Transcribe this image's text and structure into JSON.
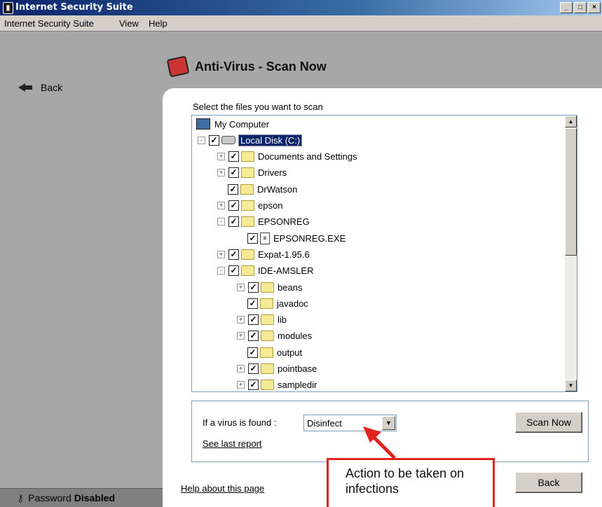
{
  "window": {
    "title": "Internet Security Suite",
    "min": "_",
    "max": "□",
    "close": "×"
  },
  "menu": [
    "Internet Security Suite",
    "View",
    "Help"
  ],
  "sidebar": {
    "back_label": "Back",
    "password_label": "Password",
    "password_status": "Disabled"
  },
  "header": {
    "title": "Anti-Virus - Scan Now"
  },
  "scan": {
    "prompt": "Select the files you want to scan",
    "tree": [
      {
        "label": "My Computer",
        "level": 0,
        "type": "computer"
      },
      {
        "label": "Local Disk (C:)",
        "level": 1,
        "type": "drive",
        "expander": "-",
        "checked": true,
        "selected": true
      },
      {
        "label": "Documents and Settings",
        "level": 2,
        "type": "folder",
        "expander": "+",
        "checked": true
      },
      {
        "label": "Drivers",
        "level": 2,
        "type": "folder",
        "expander": "+",
        "checked": true
      },
      {
        "label": "DrWatson",
        "level": 2,
        "type": "folder",
        "expander": "",
        "checked": true
      },
      {
        "label": "epson",
        "level": 2,
        "type": "folder",
        "expander": "+",
        "checked": true
      },
      {
        "label": "EPSONREG",
        "level": 2,
        "type": "folder",
        "expander": "-",
        "checked": true
      },
      {
        "label": "EPSONREG.EXE",
        "level": 3,
        "type": "file",
        "expander": "",
        "checked": true
      },
      {
        "label": "Expat-1.95.6",
        "level": 2,
        "type": "folder",
        "expander": "+",
        "checked": true
      },
      {
        "label": "IDE-AMSLER",
        "level": 2,
        "type": "folder",
        "expander": "-",
        "checked": true
      },
      {
        "label": "beans",
        "level": 3,
        "type": "folder",
        "expander": "+",
        "checked": true
      },
      {
        "label": "javadoc",
        "level": 3,
        "type": "folder",
        "expander": "",
        "checked": true
      },
      {
        "label": "lib",
        "level": 3,
        "type": "folder",
        "expander": "+",
        "checked": true
      },
      {
        "label": "modules",
        "level": 3,
        "type": "folder",
        "expander": "+",
        "checked": true
      },
      {
        "label": "output",
        "level": 3,
        "type": "folder",
        "expander": "",
        "checked": true
      },
      {
        "label": "pointbase",
        "level": 3,
        "type": "folder",
        "expander": "+",
        "checked": true
      },
      {
        "label": "sampledir",
        "level": 3,
        "type": "folder",
        "expander": "+",
        "checked": true
      }
    ]
  },
  "action": {
    "label": "If a virus is found :",
    "selected": "Disinfect",
    "report_link": "See last report",
    "scan_button": "Scan Now"
  },
  "footer": {
    "help_link": "Help about this page",
    "back_button": "Back"
  },
  "annotation": {
    "text": "Action to be taken on infections",
    "color": "#e2221c"
  }
}
